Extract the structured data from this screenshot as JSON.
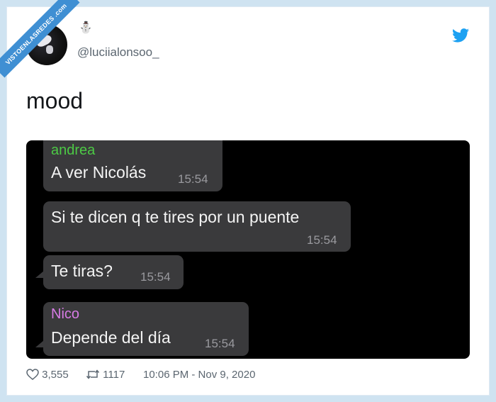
{
  "watermark": {
    "text": "VISTOENLASREDES .com"
  },
  "tweet": {
    "emoji": "⛄",
    "handle": "@luciialonsoo_",
    "text": "mood",
    "likes": "3,555",
    "retweets": "1117",
    "timestamp": "10:06 PM - Nov 9, 2020"
  },
  "chat": {
    "messages": [
      {
        "sender": "andrea",
        "text": "A ver Nicolás",
        "time": "15:54"
      },
      {
        "text": "Si te dicen q te tires por un puente",
        "time": "15:54"
      },
      {
        "text": "Te tiras?",
        "time": "15:54"
      },
      {
        "sender": "Nico",
        "text": "Depende del día",
        "time": "15:54"
      }
    ],
    "colors": {
      "andrea": "#4cc945",
      "nico": "#d87be6",
      "bubble": "#3a3a3c"
    }
  },
  "icons": [
    "heart-icon",
    "retweet-icon",
    "twitter-bird-icon"
  ],
  "colors": {
    "accent": "#1da1f2",
    "background": "#cfe3f1",
    "ribbon": "#3f8fd3"
  }
}
